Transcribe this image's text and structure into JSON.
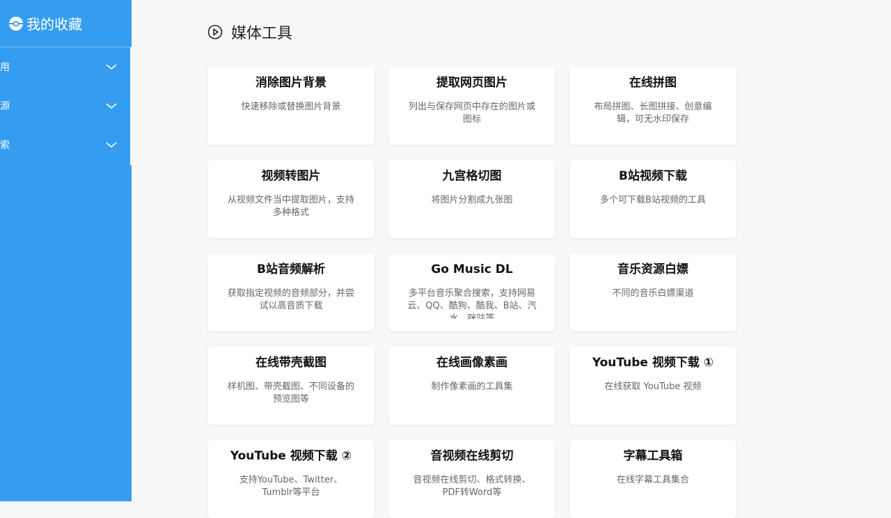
{
  "sidebar": {
    "brand": "我的收藏",
    "items": [
      {
        "label": "用"
      },
      {
        "label": "源"
      },
      {
        "label": "索"
      }
    ]
  },
  "section": {
    "title": "媒体工具",
    "icon": "play-circle-icon"
  },
  "cards": [
    {
      "title": "消除图片背景",
      "desc": "快速移除或替换图片背景"
    },
    {
      "title": "提取网页图片",
      "desc": "列出与保存网页中存在的图片或图标"
    },
    {
      "title": "在线拼图",
      "desc": "布局拼图、长图拼接、创意编辑，可无水印保存"
    },
    {
      "title": "视频转图片",
      "desc": "从视频文件当中提取图片，支持多种格式"
    },
    {
      "title": "九宫格切图",
      "desc": "将图片分割成九张图"
    },
    {
      "title": "B站视频下载",
      "desc": "多个可下载B站视频的工具"
    },
    {
      "title": "B站音频解析",
      "desc": "获取指定视频的音频部分，并尝试以高音质下载"
    },
    {
      "title": "Go Music DL",
      "desc": "多平台音乐聚合搜索，支持网易云、QQ、酷狗、酷我、B站、汽水、咪咕等"
    },
    {
      "title": "音乐资源白嫖",
      "desc": "不同的音乐白嫖渠道"
    },
    {
      "title": "在线带壳截图",
      "desc": "样机图、带壳截图、不同设备的预览图等"
    },
    {
      "title": "在线画像素画",
      "desc": "制作像素画的工具集"
    },
    {
      "title": "YouTube 视频下载 ①",
      "desc": "在线获取 YouTube 视频"
    },
    {
      "title": "YouTube 视频下载 ②",
      "desc": "支持YouTube、Twitter、Tumblr等平台"
    },
    {
      "title": "音视频在线剪切",
      "desc": "音视频在线剪切、格式转换、PDF转Word等"
    },
    {
      "title": "字幕工具箱",
      "desc": "在线字幕工具集合"
    }
  ],
  "colors": {
    "sidebar_bg": "#359df0",
    "page_bg": "#f7f8fa"
  }
}
